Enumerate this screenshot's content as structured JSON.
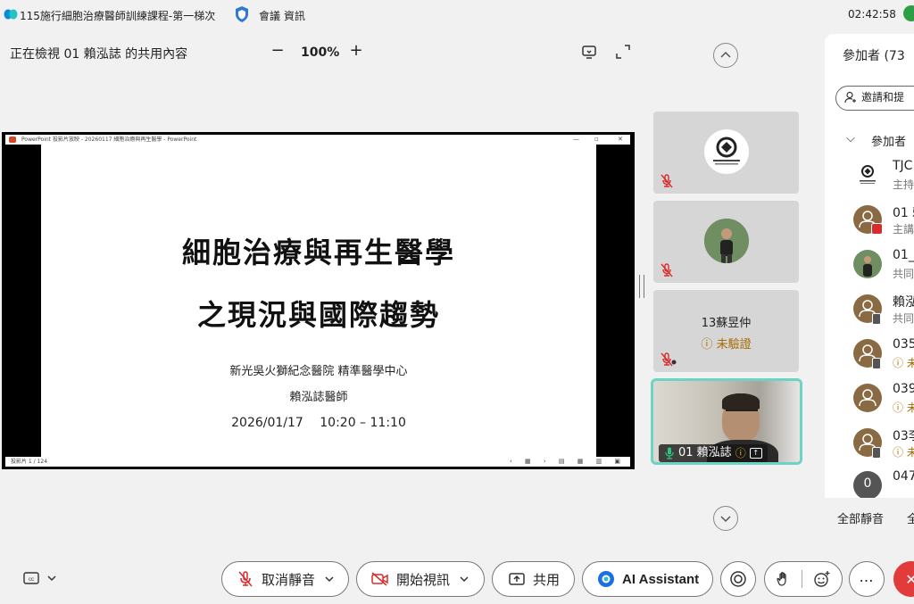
{
  "titlebar": {
    "title": "115施行細胞治療醫師訓練課程-第一梯次",
    "meeting_info": "會議 資訊",
    "clock": "02:42:58"
  },
  "toolbar": {
    "viewing": "正在檢視 01 賴泓誌 的共用內容",
    "zoom_out": "−",
    "zoom": "100%",
    "zoom_in": "+"
  },
  "ppt": {
    "window_title": "PowerPoint 投影片放映 - 20260117 細胞治療與再生醫學 - PowerPoint",
    "status": "投影片 1 / 124"
  },
  "slide": {
    "title_line1": "細胞治療與再生醫學",
    "title_line2": "之現況與國際趨勢",
    "institution": "新光吳火獅紀念醫院 精準醫學中心",
    "speaker": "賴泓誌醫師",
    "datetime": "2026/01/17　 10:20 – 11:10"
  },
  "tiles": [
    {
      "name": "TJC logo",
      "muted": true
    },
    {
      "name": "photo",
      "muted": true
    },
    {
      "name": "13蘇昱仲",
      "status": "未驗證",
      "muted": true
    },
    {
      "name": "01 賴泓誌",
      "active": true
    }
  ],
  "panel": {
    "title": "參加者 (73",
    "invite": "邀請和提",
    "group": "參加者",
    "participants": [
      {
        "name": "TJC",
        "role": "主持"
      },
      {
        "name": "01 賴",
        "role": "主講"
      },
      {
        "name": "01_",
        "role": "共同"
      },
      {
        "name": "賴泓",
        "role": "共同"
      },
      {
        "name": "035",
        "role": "未"
      },
      {
        "name": "039",
        "role": "未"
      },
      {
        "name": "03李",
        "role": "未"
      },
      {
        "name": "047",
        "role": ""
      }
    ],
    "mute_all": "全部靜音",
    "mute_all_2": "全"
  },
  "bottom": {
    "unmute": "取消靜音",
    "start_video": "開始視訊",
    "share": "共用",
    "ai": "AI Assistant"
  },
  "colors": {
    "accent_teal": "#6dd3c2",
    "end_red": "#e23b3b",
    "mute_red": "#d92b2b",
    "status_green": "#2e9e44"
  }
}
